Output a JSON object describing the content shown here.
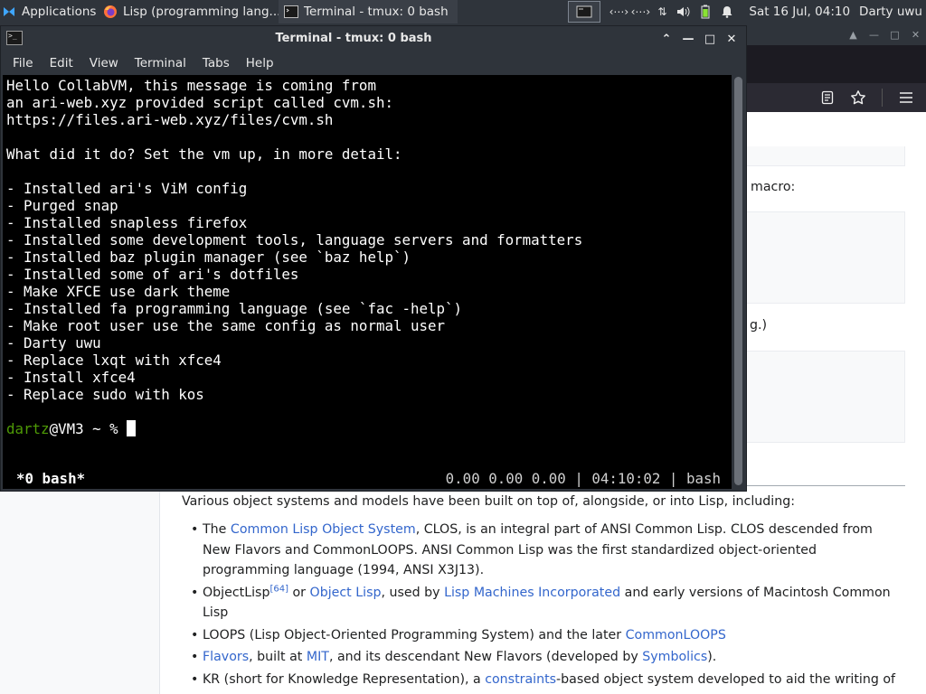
{
  "panel": {
    "apps_label": "Applications",
    "firefox_task": "Lisp (programming lang...",
    "terminal_task": "Terminal - tmux: 0 bash",
    "clock": "Sat 16 Jul, 04:10",
    "user": "Darty uwu"
  },
  "firefox": {
    "fragments": {
      "macro_tail": "macro:",
      "g_tail": "g.)"
    },
    "intro": "Various object systems and models have been built on top of, alongside, or into Lisp, including:",
    "items": [
      {
        "pre": "The ",
        "link1": "Common Lisp Object System",
        "mid": ", CLOS, is an integral part of ANSI Common Lisp. CLOS descended from New Flavors and CommonLOOPS. ANSI Common Lisp was the first standardized object-oriented programming language (1994, ANSI X3J13)."
      },
      {
        "pre": "ObjectLisp",
        "sup": "[64]",
        "a": " or ",
        "link1": "Object Lisp",
        "b": ", used by ",
        "link2": "Lisp Machines Incorporated",
        "c": " and early versions of Macintosh Common Lisp"
      },
      {
        "pre": "LOOPS (Lisp Object-Oriented Programming System) and the later ",
        "link1": "CommonLOOPS"
      },
      {
        "link1": "Flavors",
        "a": ", built at ",
        "link2": "MIT",
        "b": ", and its descendant New Flavors (developed by ",
        "link3": "Symbolics",
        "c": ")."
      },
      {
        "pre": "KR (short for Knowledge Representation), a ",
        "link1": "constraints",
        "mid": "-based object system developed to aid the writing of"
      }
    ]
  },
  "terminal": {
    "title": "Terminal - tmux: 0 bash",
    "menu": [
      "File",
      "Edit",
      "View",
      "Terminal",
      "Tabs",
      "Help"
    ],
    "lines": [
      "Hello CollabVM, this message is coming from",
      "an ari-web.xyz provided script called cvm.sh:",
      "https://files.ari-web.xyz/files/cvm.sh",
      "",
      "What did it do? Set the vm up, in more detail:",
      "",
      "- Installed ari's ViM config",
      "- Purged snap",
      "- Installed snapless firefox",
      "- Installed some development tools, language servers and formatters",
      "- Installed baz plugin manager (see `baz help`)",
      "- Installed some of ari's dotfiles",
      "- Make XFCE use dark theme",
      "- Installed fa programming language (see `fac -help`)",
      "- Make root user use the same config as normal user",
      "- Darty uwu",
      "- Replace lxqt with xfce4",
      "- Install xfce4",
      "- Replace sudo with kos"
    ],
    "prompt_user": "dartz",
    "prompt_rest": "@VM3 ~ % ",
    "tmux_left": "*0 bash*",
    "tmux_right": "0.00 0.00 0.00 | 04:10:02 | bash"
  },
  "icons": {
    "apps": "xfce-mouse-icon",
    "firefox": "firefox-icon",
    "terminal": "terminal-icon"
  },
  "colors": {
    "panel_bg": "#2f343b",
    "terminal_bg": "#000000",
    "prompt_green": "#4e9a06",
    "link": "#3366cc"
  }
}
